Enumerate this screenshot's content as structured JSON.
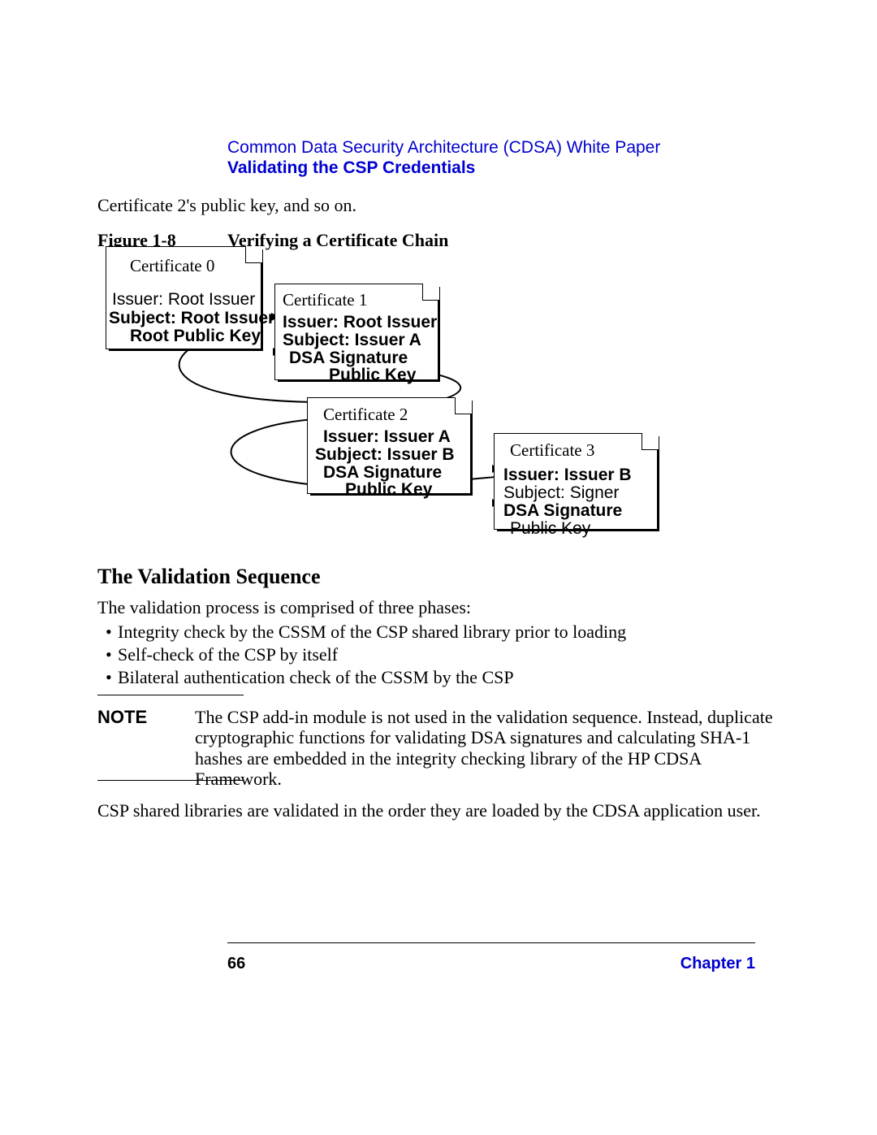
{
  "header": {
    "doc_title": "Common Data Security Architecture (CDSA) White Paper",
    "section": "Validating the CSP Credentials"
  },
  "lead": "Certificate 2's public key, and so on.",
  "figure": {
    "label": "Figure 1-8",
    "title": "Verifying a Certificate Chain",
    "cert0": {
      "title": "Certificate 0",
      "l1": "Issuer:  Root Issuer",
      "l2": "Subject:  Root Issuer",
      "l3": "Root Public Key"
    },
    "cert1": {
      "title": "Certificate 1",
      "l1": "Issuer:  Root Issuer",
      "l2": "Subject:  Issuer A",
      "l3": "DSA Signature",
      "l4": "Public Key"
    },
    "cert2": {
      "title": "Certificate 2",
      "l1": "Issuer:  Issuer A",
      "l2": "Subject:  Issuer B",
      "l3": "DSA Signature",
      "l4": "Public Key"
    },
    "cert3": {
      "title": "Certificate 3",
      "l1": "Issuer:  Issuer B",
      "l2": "Subject:  Signer",
      "l3": "DSA Signature",
      "l4": "Public Key"
    }
  },
  "section_heading": "The Validation Sequence",
  "section_intro": "The validation process is comprised of three phases:",
  "bullets": {
    "b1": "Integrity check by the CSSM of the CSP shared library prior to loading",
    "b2": "Self-check of the CSP by itself",
    "b3": "Bilateral authentication check of the CSSM by the CSP"
  },
  "note": {
    "label": "NOTE",
    "body": "The CSP add-in module is not used in the validation sequence.  Instead, duplicate cryptographic functions for validating DSA signatures and calculating SHA-1 hashes are embedded in the integrity checking library of the HP CDSA Framework."
  },
  "tail": "CSP shared libraries are validated in the order they are loaded by the CDSA application user.",
  "footer": {
    "page": "66",
    "chapter": "Chapter 1"
  }
}
